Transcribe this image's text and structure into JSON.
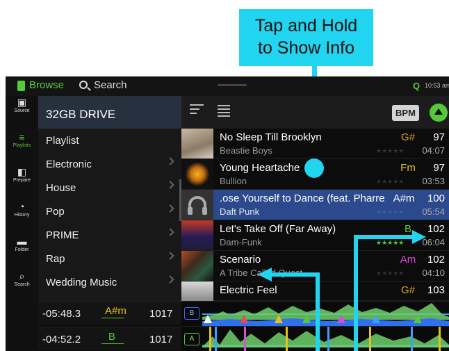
{
  "callout": {
    "line1": "Tap and Hold",
    "line2": "to Show Info"
  },
  "topbar": {
    "browse": "Browse",
    "search": "Search",
    "q": "Q",
    "time": "10:53 am"
  },
  "rail": [
    {
      "label": "Source",
      "icon": "drive-icon",
      "glyph": "▣"
    },
    {
      "label": "Playlists",
      "icon": "playlist-icon",
      "glyph": "≡"
    },
    {
      "label": "Prepare",
      "icon": "prepare-icon",
      "glyph": "◧"
    },
    {
      "label": "History",
      "icon": "clock-icon",
      "glyph": "◔"
    },
    {
      "label": "Folder",
      "icon": "folder-icon",
      "glyph": "▬"
    },
    {
      "label": "Search",
      "icon": "search-icon",
      "glyph": "⌕"
    }
  ],
  "drive": "32GB DRIVE",
  "crates": [
    {
      "label": "Playlist",
      "chevron": false
    },
    {
      "label": "Electronic",
      "chevron": true
    },
    {
      "label": "House",
      "chevron": true
    },
    {
      "label": "Pop",
      "chevron": true
    },
    {
      "label": "PRIME",
      "chevron": true
    },
    {
      "label": "Rap",
      "chevron": true
    },
    {
      "label": "Wedding Music",
      "chevron": true
    }
  ],
  "decks": [
    {
      "time": "-05:48.3",
      "key": "A#m",
      "bpm": "1017"
    },
    {
      "time": "-04:52.2",
      "key": "B",
      "bpm": "1017"
    }
  ],
  "bpm_button": "BPM",
  "tracks": [
    {
      "title": "No Sleep Till Brooklyn",
      "artist": "Beastie Boys",
      "key": "G#",
      "key_color": "#d9a21c",
      "stars": "★★★★★",
      "rated": false,
      "bpm": "97",
      "length": "04:07",
      "selected": false
    },
    {
      "title": "Young Heartache",
      "artist": "Bullion",
      "key": "Fm",
      "key_color": "#e6c21a",
      "stars": "★★★★★",
      "rated": false,
      "bpm": "97",
      "length": "03:53",
      "selected": false
    },
    {
      "title": ".ose Yourself to Dance (feat. Pharre",
      "artist": "Daft Punk",
      "key": "A#m",
      "key_color": "#ffffff",
      "stars": "★★★★★",
      "rated": false,
      "bpm": "100",
      "length": "05:54",
      "selected": true
    },
    {
      "title": "Let's Take Off (Far Away)",
      "artist": "Dam-Funk",
      "key": "B",
      "key_color": "#56c93b",
      "stars": "★★★★★",
      "rated": true,
      "bpm": "102",
      "length": "06:04",
      "selected": false
    },
    {
      "title": "Scenario",
      "artist": "A Tribe Called Quest",
      "key": "Am",
      "key_color": "#d64fd8",
      "stars": "★★★★★",
      "rated": false,
      "bpm": "102",
      "length": "04:10",
      "selected": false
    },
    {
      "title": "Electric Feel",
      "artist": "",
      "key": "G#",
      "key_color": "#d9a21c",
      "stars": "",
      "rated": false,
      "bpm": "103",
      "length": "",
      "selected": false
    }
  ],
  "waves": [
    {
      "deck": "B"
    },
    {
      "deck": "A"
    }
  ]
}
